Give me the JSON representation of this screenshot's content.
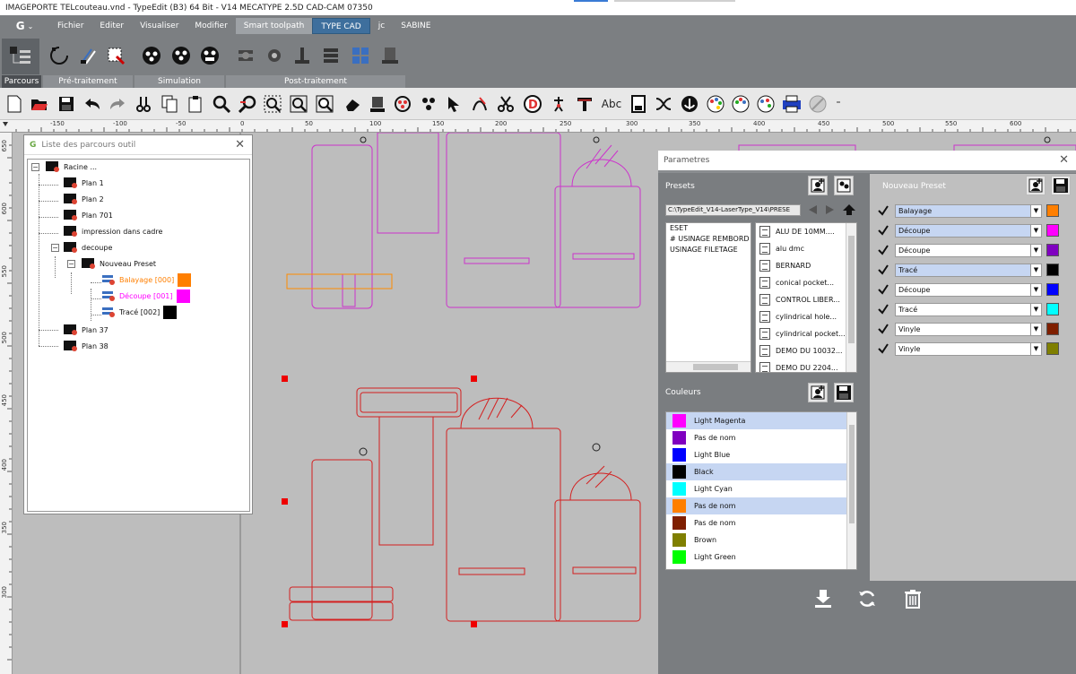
{
  "window": {
    "title": "IMAGEPORTE TELcouteau.vnd - TypeEdit (B3) 64 Bit - V14 MECATYPE 2.5D CAD-CAM 07350"
  },
  "menu": {
    "logo": "G",
    "items": [
      "Fichier",
      "Editer",
      "Visualiser",
      "Modifier",
      "Smart toolpath",
      "TYPE CAD",
      "jc",
      "SABINE"
    ]
  },
  "ribbon_tabs": [
    "Parcours",
    "Pré-traitement",
    "Simulation",
    "Post-traitement"
  ],
  "toolbar": {
    "abc_label": "Abc",
    "more": "⁼"
  },
  "ruler": {
    "h": [
      "-150",
      "-100",
      "-50",
      "0",
      "50",
      "100",
      "150",
      "200",
      "250",
      "300",
      "350",
      "400",
      "450",
      "500",
      "550",
      "600"
    ],
    "v": [
      "650",
      "600",
      "550",
      "500",
      "450",
      "400",
      "350",
      "300"
    ]
  },
  "tree_panel": {
    "title": "Liste des parcours outil",
    "nodes": [
      {
        "label": "Racine ..."
      },
      {
        "label": "Plan 1"
      },
      {
        "label": "Plan 2"
      },
      {
        "label": "Plan 701"
      },
      {
        "label": "impression dans cadre"
      },
      {
        "label": "decoupe"
      },
      {
        "label": "Nouveau Preset"
      },
      {
        "label": "Balayage [000]",
        "color": "#ff7f00"
      },
      {
        "label": "Découpe [001]",
        "color": "#ff00ff"
      },
      {
        "label": "Tracé [002]",
        "color": "#000000"
      },
      {
        "label": "Plan 37"
      },
      {
        "label": "Plan 38"
      }
    ]
  },
  "params": {
    "title": "Parametres",
    "presets_label": "Presets",
    "path": "C:\\TypeEdit_V14-LaserType_V14\\PRESE",
    "preset_list": [
      "ESET",
      "# USINAGE REMBORD",
      "USINAGE FILETAGE"
    ],
    "files": [
      "ALU DE 10MM....",
      "alu dmc",
      "BERNARD",
      "conical pocket...",
      "CONTROL LIBER...",
      "cylindrical hole...",
      "cylindrical pocket...",
      "DEMO DU  10032...",
      "DEMO DU  2204..."
    ],
    "couleurs_label": "Couleurs",
    "colors": [
      {
        "name": "Light Magenta",
        "hex": "#ff00ff",
        "selected": true
      },
      {
        "name": "Pas de nom",
        "hex": "#8000c0",
        "selected": false
      },
      {
        "name": "Light Blue",
        "hex": "#0000ff",
        "selected": false
      },
      {
        "name": "Black",
        "hex": "#000000",
        "selected": true
      },
      {
        "name": "Light Cyan",
        "hex": "#00ffff",
        "selected": false
      },
      {
        "name": "Pas de nom",
        "hex": "#ff7f00",
        "selected": true
      },
      {
        "name": "Pas de nom",
        "hex": "#7f1f00",
        "selected": false
      },
      {
        "name": "Brown",
        "hex": "#7f7f00",
        "selected": false
      },
      {
        "name": "Light Green",
        "hex": "#00ff00",
        "selected": false
      }
    ],
    "nouveau_preset_label": "Nouveau Preset",
    "np_rows": [
      {
        "value": "Balayage",
        "color": "#ff7f00",
        "hl": true
      },
      {
        "value": "Découpe",
        "color": "#ff00ff",
        "hl": true
      },
      {
        "value": "Découpe",
        "color": "#8000c0",
        "hl": false
      },
      {
        "value": "Tracé",
        "color": "#000000",
        "hl": true
      },
      {
        "value": "Découpe",
        "color": "#0000ff",
        "hl": false
      },
      {
        "value": "Tracé",
        "color": "#00ffff",
        "hl": false
      },
      {
        "value": "Vinyle",
        "color": "#7f1f00",
        "hl": false
      },
      {
        "value": "Vinyle",
        "color": "#7f7f00",
        "hl": false
      }
    ]
  }
}
